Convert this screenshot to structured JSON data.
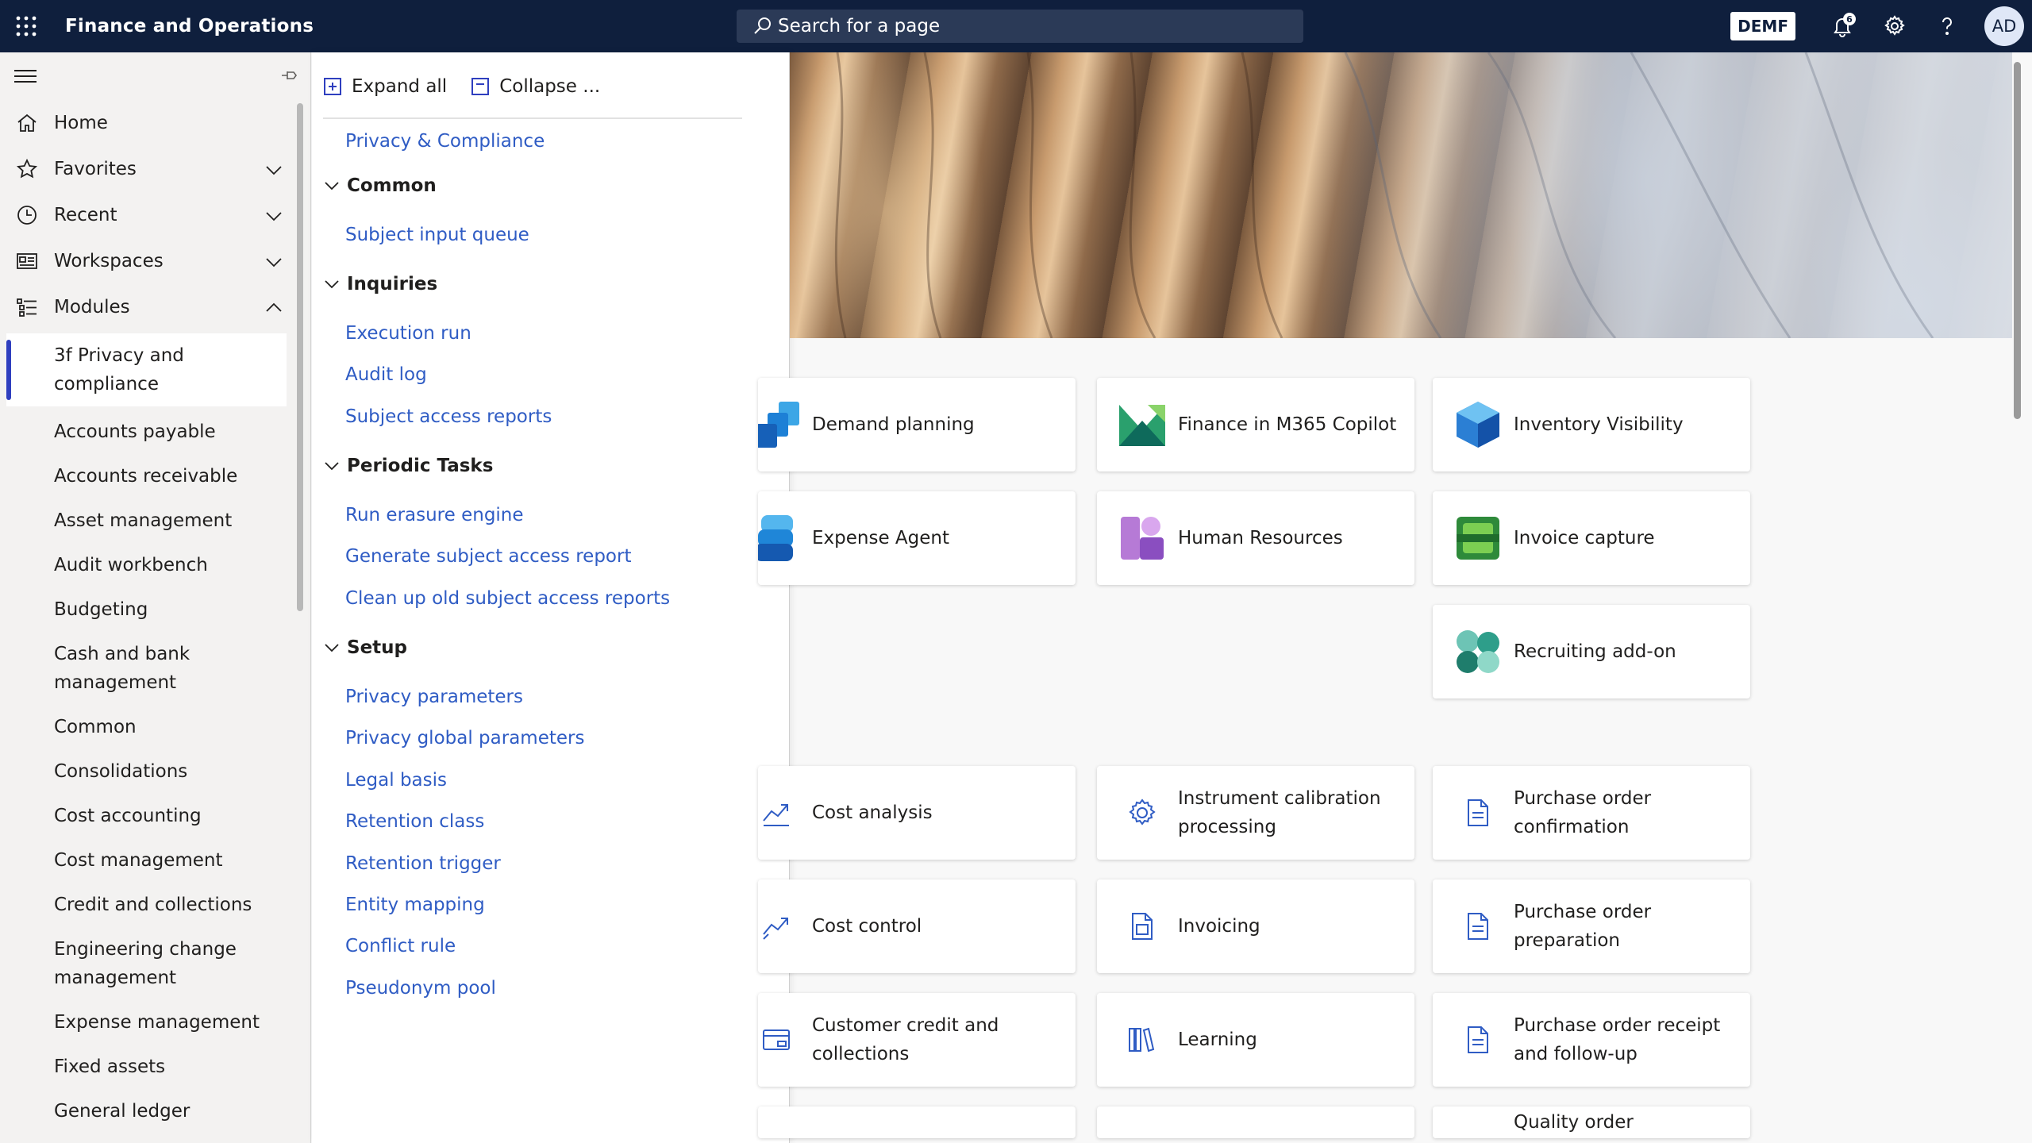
{
  "app": {
    "title": "Finance and Operations"
  },
  "search": {
    "placeholder": "Search for a page"
  },
  "header": {
    "company": "DEMF",
    "notifications_count": "6",
    "avatar_initials": "AD"
  },
  "nav": {
    "items": [
      {
        "label": "Home"
      },
      {
        "label": "Favorites"
      },
      {
        "label": "Recent"
      },
      {
        "label": "Workspaces"
      },
      {
        "label": "Modules"
      }
    ],
    "modules": [
      "3f Privacy and compliance",
      "Accounts payable",
      "Accounts receivable",
      "Asset management",
      "Audit workbench",
      "Budgeting",
      "Cash and bank management",
      "Common",
      "Consolidations",
      "Cost accounting",
      "Cost management",
      "Credit and collections",
      "Engineering change management",
      "Expense management",
      "Fixed assets",
      "General ledger"
    ]
  },
  "flyout": {
    "expand_all": "Expand all",
    "collapse": "Collapse ...",
    "top_link": "Privacy & Compliance",
    "groups": [
      {
        "title": "Common",
        "links": [
          "Subject input queue"
        ]
      },
      {
        "title": "Inquiries",
        "links": [
          "Execution run",
          "Audit log",
          "Subject access reports"
        ]
      },
      {
        "title": "Periodic Tasks",
        "links": [
          "Run erasure engine",
          "Generate subject access report",
          "Clean up old subject access reports"
        ]
      },
      {
        "title": "Setup",
        "links": [
          "Privacy parameters",
          "Privacy global parameters",
          "Legal basis",
          "Retention class",
          "Retention trigger",
          "Entity mapping",
          "Conflict rule",
          "Pseudonym pool"
        ]
      }
    ]
  },
  "tiles": {
    "apps": [
      "Demand planning",
      "Finance in M365 Copilot",
      "Inventory Visibility",
      "Expense Agent",
      "Human Resources",
      "Invoice capture",
      "Recruiting add-on"
    ],
    "workspaces": [
      "Cost analysis",
      "Instrument calibration processing",
      "Purchase order confirmation",
      "Cost control",
      "Invoicing",
      "Purchase order preparation",
      "Customer credit and collections",
      "Learning",
      "Purchase order receipt and follow-up",
      "Quality order processing"
    ]
  },
  "colors": {
    "topbar": "#0f1f3d",
    "link": "#2f5cc4",
    "accent": "#2f3fbf"
  }
}
